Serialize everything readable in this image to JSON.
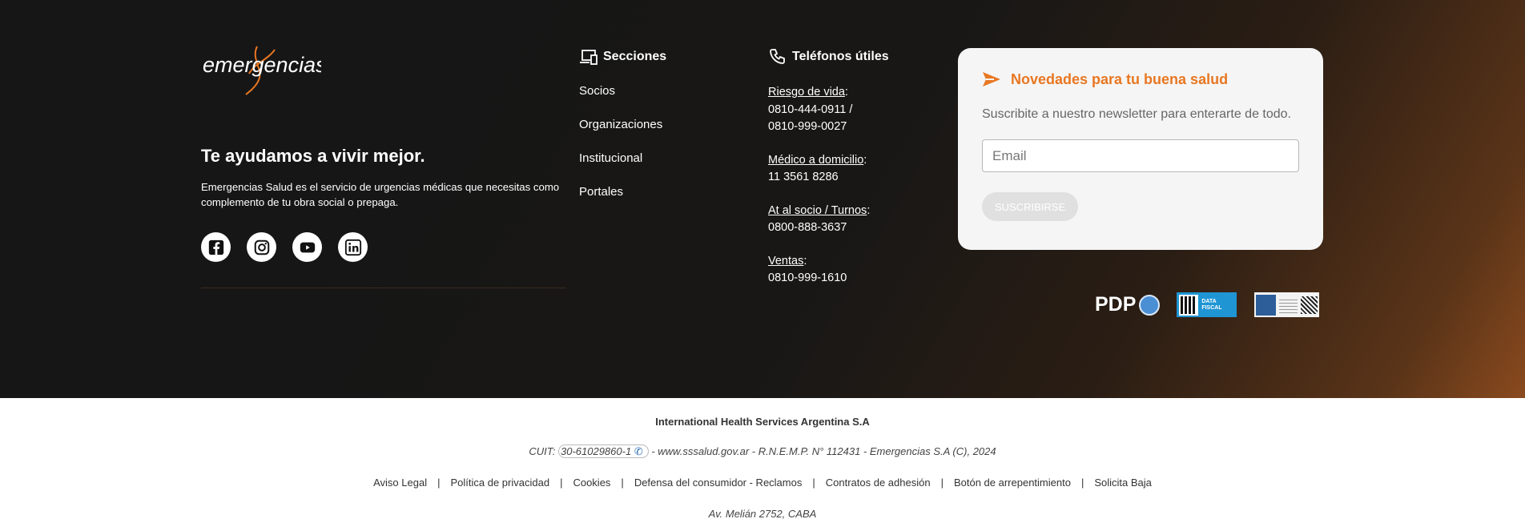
{
  "brand": {
    "logo_text": "emergencias",
    "tagline": "Te ayudamos a vivir mejor.",
    "description": "Emergencias Salud es el servicio de urgencias médicas que necesitas como complemento de tu obra social o prepaga.",
    "socials": [
      "facebook-icon",
      "instagram-icon",
      "youtube-icon",
      "linkedin-icon"
    ]
  },
  "sections": {
    "title": "Secciones",
    "items": [
      "Socios",
      "Organizaciones",
      "Institucional",
      "Portales"
    ]
  },
  "phones": {
    "title": "Teléfonos útiles",
    "items": [
      {
        "label": "Riesgo de vida",
        "numbers": "0810-444-0911 /",
        "numbers2": "0810-999-0027"
      },
      {
        "label": "Médico a domicilio",
        "numbers": "11 3561 8286",
        "numbers2": ""
      },
      {
        "label": "At al socio / Turnos",
        "numbers": "0800-888-3637",
        "numbers2": ""
      },
      {
        "label": "Ventas",
        "numbers": "0810-999-1610",
        "numbers2": ""
      }
    ]
  },
  "newsletter": {
    "title": "Novedades para tu buena salud",
    "subtitle": "Suscribite a nuestro newsletter para enterarte de todo.",
    "email_placeholder": "Email",
    "button_label": "SUSCRIBIRSE"
  },
  "badges": {
    "pdp": "PDP",
    "datafiscal": "DATA FISCAL"
  },
  "footer": {
    "company": "International Health Services Argentina S.A",
    "cuit_prefix": "CUIT:",
    "cuit_number": "30-61029860-1",
    "cuit_rest": "- www.sssalud.gov.ar - R.N.E.M.P. N° 112431 - Emergencias S.A (C), 2024",
    "links": [
      "Aviso Legal",
      "Política de privacidad",
      "Cookies",
      "Defensa del consumidor - Reclamos",
      "Contratos de adhesión",
      "Botón de arrepentimiento",
      "Solicita Baja"
    ],
    "address": "Av. Melián 2752, CABA"
  },
  "colors": {
    "accent": "#e87722",
    "dark_bg": "#161616",
    "card_bg": "#f5f5f5"
  }
}
